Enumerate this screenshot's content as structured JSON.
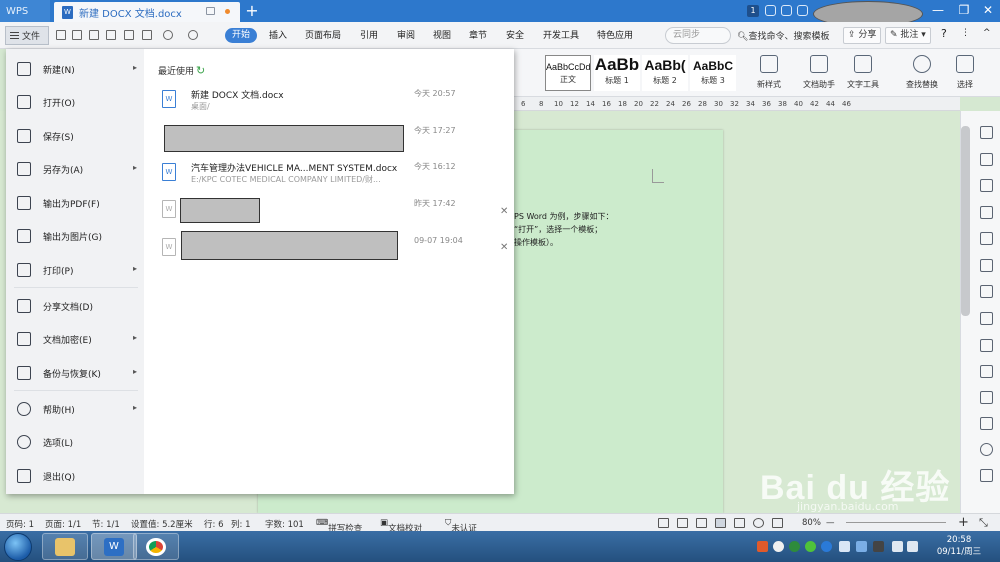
{
  "titlebar": {
    "app_name": "WPS",
    "doc_tab": "新建 DOCX 文档.docx",
    "badge_count": "1"
  },
  "menubar": {
    "file_label": "文件",
    "tabs": [
      "开始",
      "插入",
      "页面布局",
      "引用",
      "审阅",
      "视图",
      "章节",
      "安全",
      "开发工具",
      "特色应用"
    ],
    "active_tab": "开始",
    "cloud_label": "云同步",
    "search_label": "查找命令、搜索模板",
    "share_label": "分享",
    "annotate_label": "批注"
  },
  "ribbon": {
    "styles": [
      {
        "preview": "AaBbCcDd",
        "label": "正文"
      },
      {
        "preview": "AaBb",
        "label": "标题 1"
      },
      {
        "preview": "AaBb(",
        "label": "标题 2"
      },
      {
        "preview": "AaBbC",
        "label": "标题 3"
      }
    ],
    "tools": [
      {
        "label": "新样式"
      },
      {
        "label": "文档助手"
      },
      {
        "label": "文字工具"
      },
      {
        "label": "查找替换"
      },
      {
        "label": "选择"
      }
    ]
  },
  "ruler_numbers": [
    "6",
    "8",
    "10",
    "12",
    "14",
    "16",
    "18",
    "20",
    "22",
    "24",
    "26",
    "28",
    "30",
    "32",
    "34",
    "36",
    "38",
    "40",
    "42",
    "44",
    "46"
  ],
  "file_menu": {
    "items": [
      {
        "label": "新建(N)",
        "has_arrow": true
      },
      {
        "label": "打开(O)",
        "has_arrow": false
      },
      {
        "label": "保存(S)",
        "has_arrow": false
      },
      {
        "label": "另存为(A)",
        "has_arrow": true
      },
      {
        "label": "输出为PDF(F)",
        "has_arrow": false
      },
      {
        "label": "输出为图片(G)",
        "has_arrow": false
      },
      {
        "label": "打印(P)",
        "has_arrow": true
      },
      {
        "label": "分享文档(D)",
        "has_arrow": false
      },
      {
        "label": "文档加密(E)",
        "has_arrow": true
      },
      {
        "label": "备份与恢复(K)",
        "has_arrow": true
      },
      {
        "label": "帮助(H)",
        "has_arrow": true
      },
      {
        "label": "选项(L)",
        "has_arrow": false
      },
      {
        "label": "退出(Q)",
        "has_arrow": false
      }
    ],
    "recent_title": "最近使用",
    "recent": [
      {
        "name": "新建 DOCX 文档.docx",
        "path": "桌面/",
        "time": "今天 20:57"
      },
      {
        "name": "",
        "path": "",
        "time": "今天 17:27"
      },
      {
        "name": "汽车管理办法VEHICLE MA...MENT SYSTEM.docx",
        "path": "E:/KPC COTEC MEDICAL COMPANY LIMITED/财...",
        "time": "今天 16:12"
      },
      {
        "name": "",
        "path": "",
        "time": "昨天 17:42"
      },
      {
        "name": "",
        "path": "",
        "time": "09-07 19:04"
      }
    ]
  },
  "doc_text": [
    "PS Word 为例，步骤如下：",
    "“打开”，选择一个模板；",
    "操作模板）。"
  ],
  "statusbar": {
    "page_num": "页码: 1",
    "pages": "页面: 1/1",
    "section": "节: 1/1",
    "position": "设置值: 5.2厘米",
    "row": "行: 6",
    "col": "列: 1",
    "word_count": "字数: 101",
    "spell_check": "拼写检查",
    "doc_proof": "文档校对",
    "cert": "未认证",
    "zoom": "80%"
  },
  "clock": {
    "time": "20:58",
    "date": "09/11/周三"
  },
  "watermark": {
    "brand": "Bai du 经验",
    "url": "jingyan.baidu.com"
  },
  "colors": {
    "title_bar": "#2d78cc",
    "accent": "#3a7fd5",
    "doc_bg": "#ccebcc"
  }
}
